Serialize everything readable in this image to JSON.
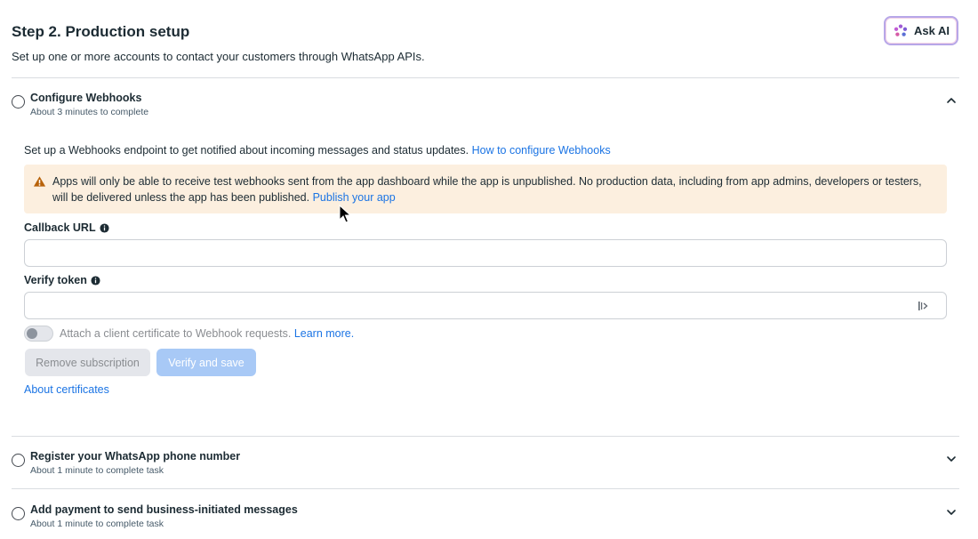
{
  "header": {
    "title": "Step 2. Production setup",
    "subtitle": "Set up one or more accounts to contact your customers through WhatsApp APIs."
  },
  "ask_ai": {
    "label": "Ask AI",
    "icon": "sparkle-icon"
  },
  "steps": [
    {
      "title": "Configure Webhooks",
      "subtitle": "About 3 minutes to complete",
      "expanded": true
    },
    {
      "title": "Register your WhatsApp phone number",
      "subtitle": "About 1 minute to complete task",
      "expanded": false
    },
    {
      "title": "Add payment to send business-initiated messages",
      "subtitle": "About 1 minute to complete task",
      "expanded": false
    }
  ],
  "webhooks": {
    "description": "Set up a Webhooks endpoint to get notified about incoming messages and status updates.",
    "description_link": "How to configure Webhooks",
    "warning_text": "Apps will only be able to receive test webhooks sent from the app dashboard while the app is unpublished. No production data, including from app admins, developers or testers, will be delivered unless the app has been published.",
    "warning_link": "Publish your app",
    "callback_label": "Callback URL",
    "callback_value": "",
    "verify_label": "Verify token",
    "verify_value": "",
    "cert_toggle_label": "Attach a client certificate to Webhook requests.",
    "cert_toggle_link": "Learn more.",
    "cert_toggle_on": false,
    "remove_button": "Remove subscription",
    "verify_button": "Verify and save",
    "about_certificates": "About certificates"
  },
  "colors": {
    "link": "#1b74e4",
    "warning_bg": "#fcefdf",
    "warning_icon": "#d97706",
    "primary_disabled": "#a8c9f6"
  }
}
